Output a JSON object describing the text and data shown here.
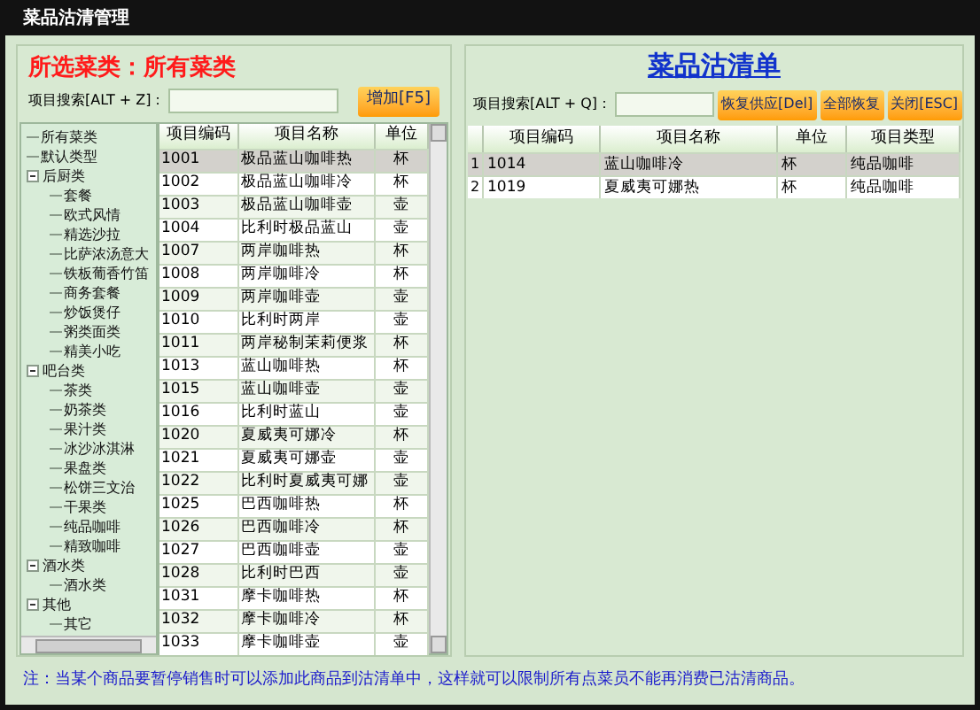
{
  "window": {
    "title": "菜品沽清管理"
  },
  "left": {
    "heading": "所选菜类：所有菜类",
    "search_label": "项目搜索[ALT + Z]：",
    "add_button": "增加[F5]",
    "tree": [
      {
        "label": "所有菜类"
      },
      {
        "label": "默认类型"
      },
      {
        "label": "后厨类",
        "expanded": true,
        "children": [
          {
            "label": "套餐"
          },
          {
            "label": "欧式风情"
          },
          {
            "label": "精选沙拉"
          },
          {
            "label": "比萨浓汤意大"
          },
          {
            "label": "铁板葡香竹笛"
          },
          {
            "label": "商务套餐"
          },
          {
            "label": "炒饭煲仔"
          },
          {
            "label": "粥类面类"
          },
          {
            "label": "精美小吃"
          }
        ]
      },
      {
        "label": "吧台类",
        "expanded": true,
        "children": [
          {
            "label": "茶类"
          },
          {
            "label": "奶茶类"
          },
          {
            "label": "果汁类"
          },
          {
            "label": "冰沙冰淇淋"
          },
          {
            "label": "果盘类"
          },
          {
            "label": "松饼三文治"
          },
          {
            "label": "干果类"
          },
          {
            "label": "纯品咖啡"
          },
          {
            "label": "精致咖啡"
          }
        ]
      },
      {
        "label": "酒水类",
        "expanded": true,
        "children": [
          {
            "label": "酒水类"
          }
        ]
      },
      {
        "label": "其他",
        "expanded": true,
        "children": [
          {
            "label": "其它"
          }
        ]
      }
    ],
    "table": {
      "columns": [
        "项目编码",
        "项目名称",
        "单位"
      ],
      "rows": [
        {
          "cells": [
            "1001",
            "极品蓝山咖啡热",
            "杯"
          ],
          "selected": true
        },
        {
          "cells": [
            "1002",
            "极品蓝山咖啡冷",
            "杯"
          ],
          "selected": false
        },
        {
          "cells": [
            "1003",
            "极品蓝山咖啡壶",
            "壶"
          ],
          "selected": false
        },
        {
          "cells": [
            "1004",
            "比利时极品蓝山",
            "壶"
          ],
          "selected": false
        },
        {
          "cells": [
            "1007",
            "两岸咖啡热",
            "杯"
          ],
          "selected": false
        },
        {
          "cells": [
            "1008",
            "两岸咖啡冷",
            "杯"
          ],
          "selected": false
        },
        {
          "cells": [
            "1009",
            "两岸咖啡壶",
            "壶"
          ],
          "selected": false
        },
        {
          "cells": [
            "1010",
            "比利时两岸",
            "壶"
          ],
          "selected": false
        },
        {
          "cells": [
            "1011",
            "两岸秘制茉莉便浆",
            "杯"
          ],
          "selected": false
        },
        {
          "cells": [
            "1013",
            "蓝山咖啡热",
            "杯"
          ],
          "selected": false
        },
        {
          "cells": [
            "1015",
            "蓝山咖啡壶",
            "壶"
          ],
          "selected": false
        },
        {
          "cells": [
            "1016",
            "比利时蓝山",
            "壶"
          ],
          "selected": false
        },
        {
          "cells": [
            "1020",
            "夏威夷可娜冷",
            "杯"
          ],
          "selected": false
        },
        {
          "cells": [
            "1021",
            "夏威夷可娜壶",
            "壶"
          ],
          "selected": false
        },
        {
          "cells": [
            "1022",
            "比利时夏威夷可娜",
            "壶"
          ],
          "selected": false
        },
        {
          "cells": [
            "1025",
            "巴西咖啡热",
            "杯"
          ],
          "selected": false
        },
        {
          "cells": [
            "1026",
            "巴西咖啡冷",
            "杯"
          ],
          "selected": false
        },
        {
          "cells": [
            "1027",
            "巴西咖啡壶",
            "壶"
          ],
          "selected": false
        },
        {
          "cells": [
            "1028",
            "比利时巴西",
            "壶"
          ],
          "selected": false
        },
        {
          "cells": [
            "1031",
            "摩卡咖啡热",
            "杯"
          ],
          "selected": false
        },
        {
          "cells": [
            "1032",
            "摩卡咖啡冷",
            "杯"
          ],
          "selected": false
        },
        {
          "cells": [
            "1033",
            "摩卡咖啡壶",
            "壶"
          ],
          "selected": false
        }
      ]
    }
  },
  "right": {
    "heading": "菜品沽清单",
    "search_label": "项目搜索[ALT + Q]：",
    "buttons": [
      "恢复供应[Del]",
      "全部恢复",
      "关闭[ESC]"
    ],
    "table": {
      "columns": [
        "项目编码",
        "项目名称",
        "单位",
        "项目类型"
      ],
      "rows": [
        {
          "index": "1",
          "cells": [
            "1014",
            "蓝山咖啡冷",
            "杯",
            "纯品咖啡"
          ],
          "selected": true
        },
        {
          "index": "2",
          "cells": [
            "1019",
            "夏威夷可娜热",
            "杯",
            "纯品咖啡"
          ],
          "selected": false
        }
      ]
    }
  },
  "note": "注：当某个商品要暂停销售时可以添加此商品到沽清单中，这样就可以限制所有点菜员不能再消费已沽清商品。"
}
